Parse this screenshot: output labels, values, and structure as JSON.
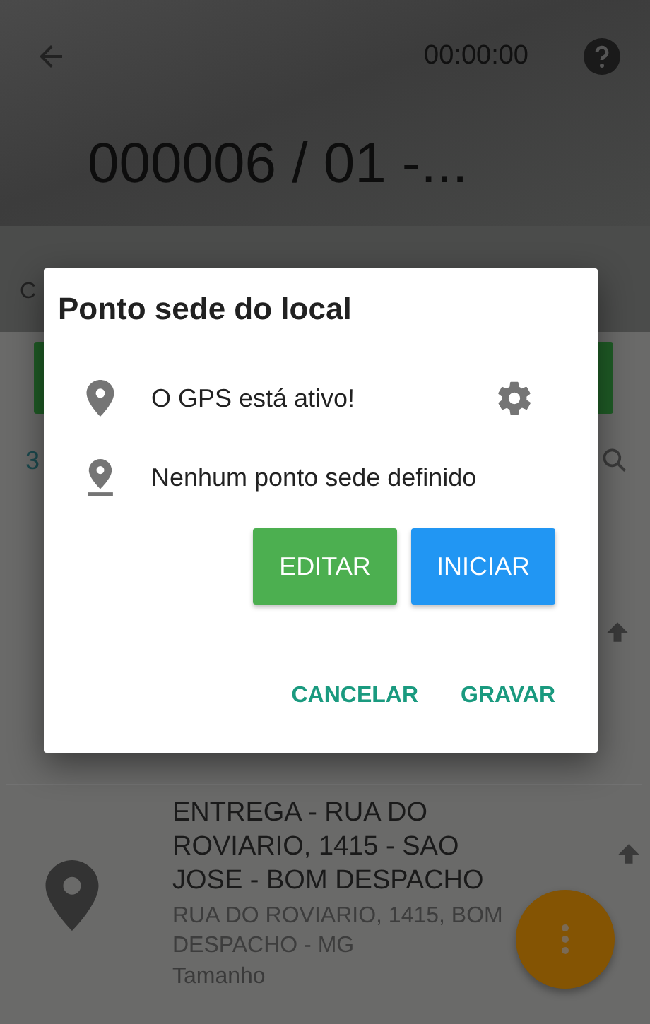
{
  "header": {
    "time": "00:00:00",
    "title": "000006 / 01 -..."
  },
  "background": {
    "section_label": "C",
    "count": "3"
  },
  "list_item": {
    "title": "ENTREGA - RUA DO ROVIARIO, 1415 - SAO JOSE - BOM DESPACHO",
    "address": "RUA DO ROVIARIO, 1415, BOM DESPACHO - MG",
    "detail": "Tamanho"
  },
  "dialog": {
    "title": "Ponto sede do local",
    "rows": [
      {
        "kind": "gps",
        "text": "O GPS está ativo!"
      },
      {
        "kind": "point",
        "text": "Nenhum ponto sede definido"
      }
    ],
    "buttons": [
      {
        "label": "EDITAR",
        "color": "#4caf50"
      },
      {
        "label": "INICIAR",
        "color": "#2196f3"
      }
    ],
    "actions": [
      "CANCELAR",
      "GRAVAR"
    ]
  }
}
